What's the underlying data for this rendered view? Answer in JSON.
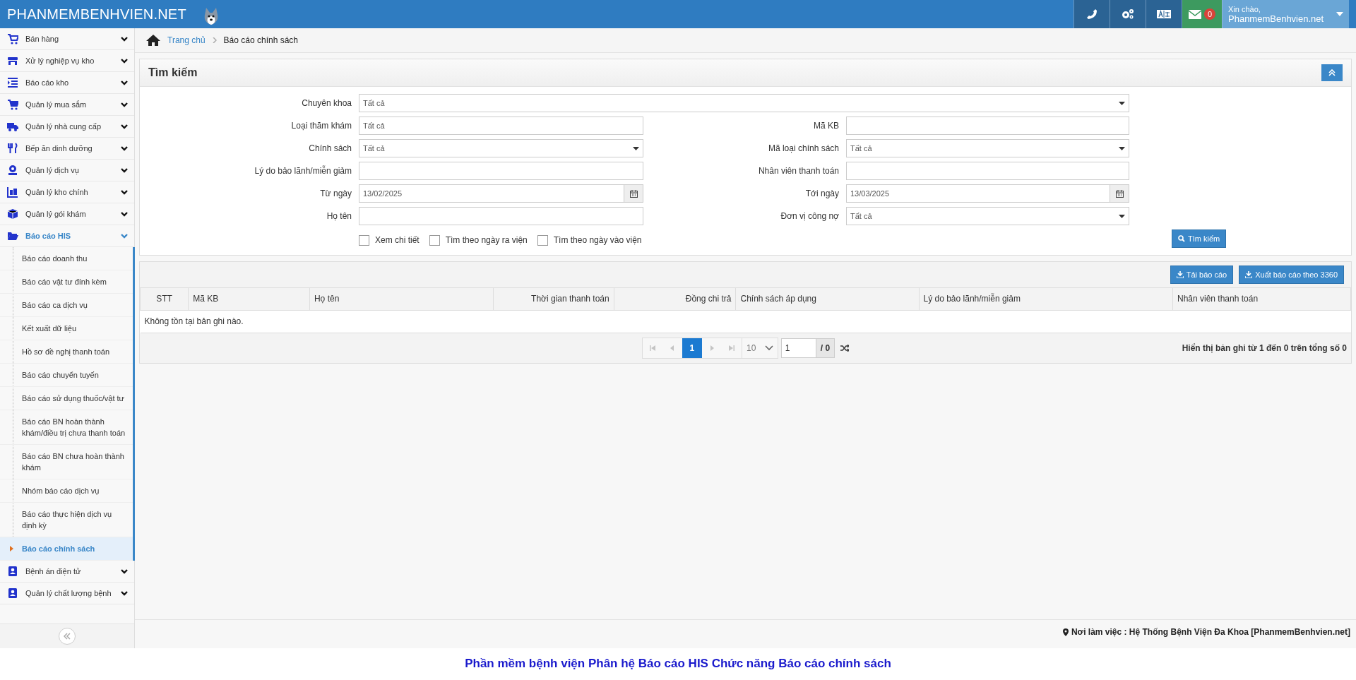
{
  "header": {
    "logo": "PHANMEMBENHVIEN.NET",
    "mail_count": "0",
    "greeting": "Xin chào,",
    "user": "PhanmemBenhvien.net"
  },
  "sidebar": {
    "items": [
      {
        "label": "Bán hàng",
        "expanded": false,
        "selected": false
      },
      {
        "label": "Xử lý nghiệp vụ kho",
        "expanded": false,
        "selected": false
      },
      {
        "label": "Báo cáo kho",
        "expanded": false,
        "selected": false
      },
      {
        "label": "Quản lý mua sắm",
        "expanded": false,
        "selected": false
      },
      {
        "label": "Quản lý nhà cung cấp",
        "expanded": false,
        "selected": false
      },
      {
        "label": "Bếp ăn dinh dưỡng",
        "expanded": false,
        "selected": false
      },
      {
        "label": "Quản lý dịch vụ",
        "expanded": false,
        "selected": false
      },
      {
        "label": "Quản lý kho chính",
        "expanded": false,
        "selected": false
      },
      {
        "label": "Quản lý gói khám",
        "expanded": false,
        "selected": false
      },
      {
        "label": "Báo cáo HIS",
        "expanded": true,
        "selected": true,
        "children": [
          {
            "label": "Báo cáo doanh thu",
            "selected": false
          },
          {
            "label": "Báo cáo vật tư đính kèm",
            "selected": false
          },
          {
            "label": "Báo cáo ca dịch vụ",
            "selected": false
          },
          {
            "label": "Kết xuất dữ liệu",
            "selected": false
          },
          {
            "label": "Hồ sơ đề nghị thanh toán",
            "selected": false
          },
          {
            "label": "Báo cáo chuyển tuyến",
            "selected": false
          },
          {
            "label": "Báo cáo sử dụng thuốc/vật tư",
            "selected": false
          },
          {
            "label": "Báo cáo BN hoàn thành khám/điều trị chưa thanh toán",
            "selected": false
          },
          {
            "label": "Báo cáo BN chưa hoàn thành khám",
            "selected": false
          },
          {
            "label": "Nhóm báo cáo dịch vụ",
            "selected": false
          },
          {
            "label": "Báo cáo thực hiện dịch vụ định kỳ",
            "selected": false
          },
          {
            "label": "Báo cáo chính sách",
            "selected": true
          }
        ]
      },
      {
        "label": "Bệnh án điện tử",
        "expanded": false,
        "selected": false
      },
      {
        "label": "Quản lý chất lượng bệnh",
        "expanded": false,
        "selected": false
      }
    ]
  },
  "breadcrumb": [
    "Trang chủ",
    "Báo cáo chính sách"
  ],
  "search": {
    "title": "Tìm kiếm",
    "rows": [
      [
        {
          "label": "Chuyên khoa",
          "kind": "select",
          "value": "Tất cả"
        }
      ],
      [
        {
          "label": "Loại thăm khám",
          "kind": "text",
          "value": "Tất cả"
        },
        {
          "label": "Mã KB",
          "kind": "text"
        }
      ],
      [
        {
          "label": "Chính sách",
          "kind": "select",
          "value": "Tất cả"
        },
        {
          "label": "Mã loại chính sách",
          "kind": "select",
          "value": "Tất cả"
        }
      ],
      [
        {
          "label": "Lý do bảo lãnh/miễn giảm",
          "kind": "text"
        },
        {
          "label": "Nhân viên thanh toán",
          "kind": "text"
        }
      ],
      [
        {
          "label": "Từ ngày",
          "kind": "date",
          "value": "13/02/2025"
        },
        {
          "label": "Tới ngày",
          "kind": "date",
          "value": "13/03/2025"
        }
      ],
      [
        {
          "label": "Họ tên",
          "kind": "text"
        },
        {
          "label": "Đơn vị công nợ",
          "kind": "select",
          "value": "Tất cả"
        }
      ]
    ],
    "checkboxes": [
      {
        "label": "Xem chi tiết",
        "checked": false
      },
      {
        "label": "Tìm theo ngày ra viện",
        "checked": false
      },
      {
        "label": "Tìm theo ngày vào viện",
        "checked": false
      }
    ],
    "button": "Tìm kiếm"
  },
  "results": {
    "buttons": [
      "Tải báo cáo",
      "Xuất báo cáo theo 3360"
    ],
    "columns": [
      "STT",
      "Mã KB",
      "Họ tên",
      "Thời gian thanh toán",
      "Đồng chi trả",
      "Chính sách áp dụng",
      "Lý do bảo lãnh/miễn giảm",
      "Nhân viên thanh toán"
    ],
    "empty_message": "Không tồn tại bản ghi nào.",
    "pagination": {
      "pages": [
        {
          "label": "1",
          "selected": true
        }
      ],
      "page_size": "10",
      "page_input": "1",
      "page_total": "/ 0",
      "summary": "Hiển thị bản ghi từ 1 đến 0 trên tổng số 0"
    }
  },
  "footer": {
    "workplace": "Nơi làm việc : Hệ Thống Bệnh Viện Đa Khoa [PhanmemBenhvien.net]"
  },
  "caption": "Phần mềm bệnh viện Phân hệ Báo cáo HIS Chức năng Báo cáo chính sách"
}
